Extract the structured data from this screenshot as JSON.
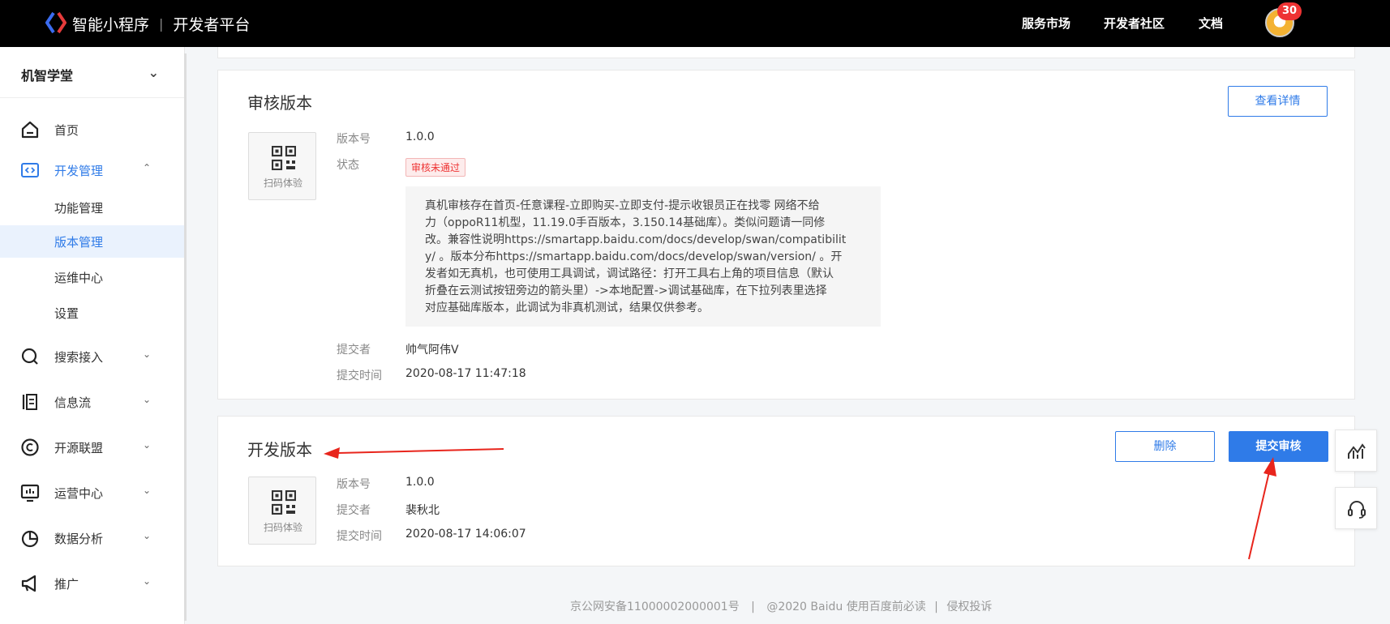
{
  "header": {
    "brand_name": "智能小程序",
    "platform": "开发者平台",
    "nav": [
      "服务市场",
      "开发者社区",
      "文档"
    ],
    "notification_count": "30"
  },
  "sidebar": {
    "app_name": "机智学堂",
    "items": [
      {
        "label": "首页",
        "icon": "home-icon"
      },
      {
        "label": "开发管理",
        "icon": "code-icon",
        "expanded": true,
        "children": [
          "功能管理",
          "版本管理",
          "运维中心",
          "设置"
        ],
        "selected_child": "版本管理"
      },
      {
        "label": "搜索接入",
        "icon": "search-icon"
      },
      {
        "label": "信息流",
        "icon": "feed-icon"
      },
      {
        "label": "开源联盟",
        "icon": "copyright-icon"
      },
      {
        "label": "运营中心",
        "icon": "monitor-icon"
      },
      {
        "label": "数据分析",
        "icon": "pie-chart-icon"
      },
      {
        "label": "推广",
        "icon": "megaphone-icon"
      }
    ]
  },
  "review_card": {
    "title": "审核版本",
    "details_button": "查看详情",
    "qr_label": "扫码体验",
    "fields": {
      "version_label": "版本号",
      "version": "1.0.0",
      "status_label": "状态",
      "status": "审核未通过",
      "submitter_label": "提交者",
      "submitter": "帅气阿伟V",
      "time_label": "提交时间",
      "time": "2020-08-17 11:47:18"
    },
    "reason_lines": [
      "真机审核存在首页-任意课程-立即购买-立即支付-提示收银员正在找零 网络不给",
      "力（oppoR11机型，11.19.0手百版本，3.150.14基础库）。类似问题请一同修",
      "改。兼容性说明https://smartapp.baidu.com/docs/develop/swan/compatibilit",
      "y/ 。版本分布https://smartapp.baidu.com/docs/develop/swan/version/ 。开",
      "发者如无真机，也可使用工具调试，调试路径：打开工具右上角的项目信息（默认",
      "折叠在云测试按钮旁边的箭头里）->本地配置->调试基础库，在下拉列表里选择",
      "对应基础库版本，此调试为非真机测试，结果仅供参考。"
    ]
  },
  "dev_card": {
    "title": "开发版本",
    "delete_button": "删除",
    "submit_button": "提交审核",
    "qr_label": "扫码体验",
    "fields": {
      "version_label": "版本号",
      "version": "1.0.0",
      "submitter_label": "提交者",
      "submitter": "裴秋北",
      "time_label": "提交时间",
      "time": "2020-08-17 14:06:07"
    }
  },
  "footer": {
    "icp": "京公网安备11000002000001号",
    "copyright": "@2020 Baidu 使用百度前必读",
    "report": "侵权投诉"
  },
  "colors": {
    "accent": "#2f7be8",
    "error": "#e33333",
    "annotation": "#e8251c"
  }
}
